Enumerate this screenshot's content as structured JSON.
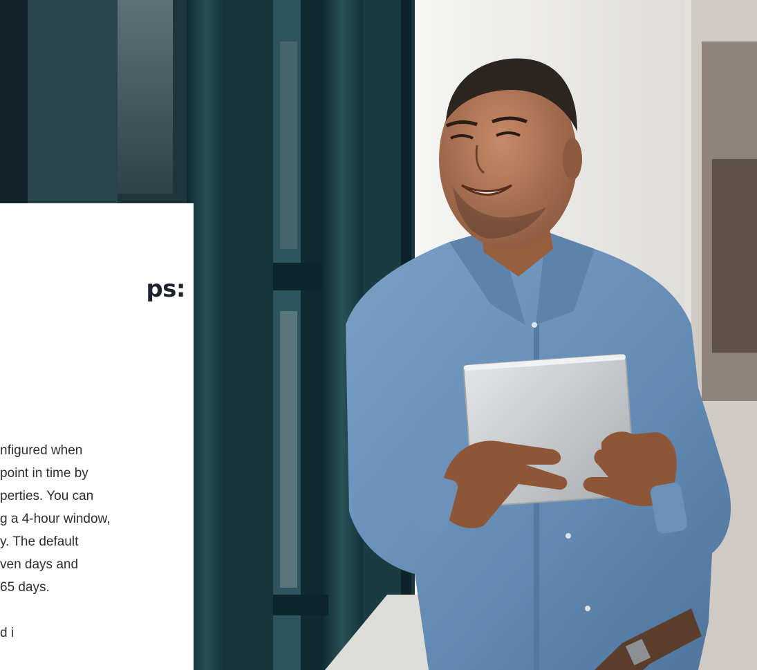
{
  "card": {
    "heading": "ps:",
    "body_lines": [
      "nfigured when",
      " point in time by",
      "perties. You can",
      "g a 4-hour window,",
      "y. The default",
      "ven days and",
      "65 days."
    ],
    "trailing_line": "d         i"
  },
  "photo": {
    "subject": "smiling man in blue shirt holding tablet by window",
    "colors": {
      "window_frame": "#1f3e45",
      "shirt": "#6f95bd",
      "wall": "#f2f2f0",
      "tablet": "#c9cccf",
      "skin": "#a36a4c"
    }
  }
}
